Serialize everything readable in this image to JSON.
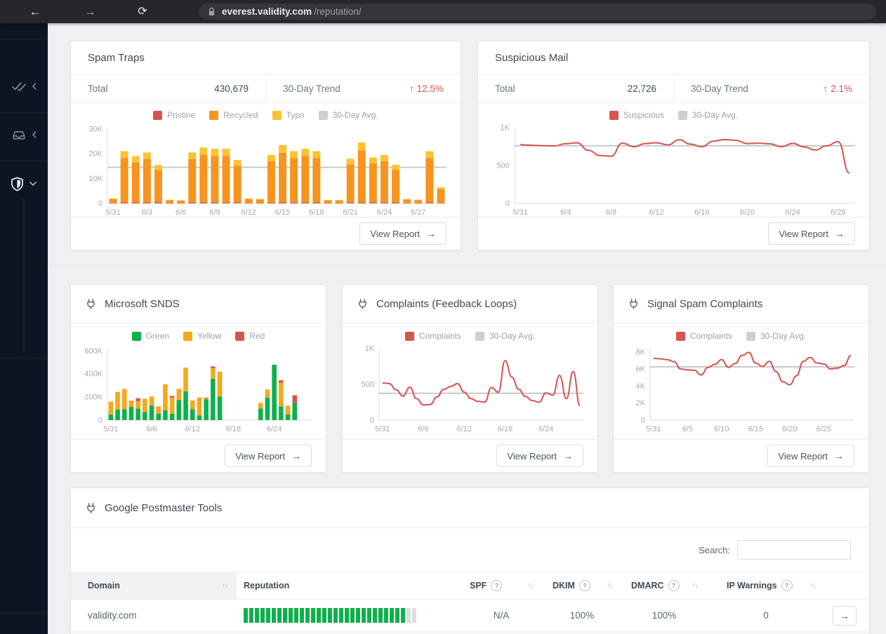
{
  "browser": {
    "url_host": "everest.validity.com",
    "url_path": "/reputation/"
  },
  "icons": {
    "back": "←",
    "forward": "→",
    "reload": "⟳",
    "trend_up": "↑",
    "arrow_right": "→",
    "sort": "↑↓",
    "help": "?"
  },
  "sidebar": {
    "items": [
      {
        "icon": "double-check-icon",
        "state": "collapsed"
      },
      {
        "icon": "inbox-tray-icon",
        "state": "collapsed"
      },
      {
        "icon": "shield-icon",
        "state": "expanded",
        "active": true
      }
    ]
  },
  "cards": {
    "spam_traps": {
      "title": "Spam Traps",
      "total_label": "Total",
      "total_value": "430,679",
      "trend_label": "30-Day Trend",
      "trend_value": "12.5%",
      "view_report_label": "View Report",
      "chart": {
        "type": "stacked_bar",
        "ymax": 30.5,
        "yticks": [
          [
            0,
            "0"
          ],
          [
            10,
            "10K"
          ],
          [
            20,
            "20K"
          ],
          [
            30,
            "30K"
          ]
        ],
        "avg": 14.5,
        "avg_label": "30-Day Avg.",
        "avg_color": "#c6c9cc",
        "unit": "K",
        "xlabels": [
          "5/31",
          "",
          "",
          "6/3",
          "",
          "",
          "6/6",
          "",
          "",
          "6/9",
          "",
          "",
          "6/12",
          "",
          "",
          "6/15",
          "",
          "",
          "6/18",
          "",
          "",
          "6/21",
          "",
          "",
          "6/24",
          "",
          "",
          "6/27",
          "",
          ""
        ],
        "series": [
          {
            "name": "Pristine",
            "color": "#d9534f",
            "values": [
              0.1,
              0.4,
              0.4,
              0.4,
              0.4,
              0.1,
              0.1,
              0.4,
              0.4,
              0.4,
              0.4,
              0.4,
              0.1,
              0.1,
              0.4,
              0.4,
              0.4,
              0.4,
              0.4,
              0.1,
              0.1,
              0.4,
              0.4,
              0.4,
              0.4,
              0.4,
              0.1,
              0.1,
              0.4,
              0.2
            ]
          },
          {
            "name": "Recycled",
            "color": "#f7941e",
            "values": [
              1.6,
              17.9,
              16.1,
              17.4,
              13.1,
              1.2,
              1.0,
              17.4,
              19.2,
              18.7,
              18.7,
              14.8,
              1.6,
              1.5,
              16.6,
              20.0,
              17.9,
              18.7,
              17.9,
              1.1,
              1.1,
              15.3,
              20.9,
              15.7,
              16.6,
              13.1,
              1.5,
              1.2,
              17.9,
              5.5
            ]
          },
          {
            "name": "Typo",
            "color": "#fdc330",
            "values": [
              0.3,
              2.7,
              2.5,
              2.7,
              2.0,
              0.2,
              0.2,
              2.7,
              2.9,
              2.9,
              2.9,
              2.3,
              0.3,
              0.2,
              2.5,
              3.1,
              2.7,
              2.9,
              2.7,
              0.2,
              0.2,
              2.3,
              3.2,
              2.4,
              2.5,
              2.0,
              0.2,
              0.2,
              2.7,
              0.8
            ]
          }
        ]
      }
    },
    "suspicious_mail": {
      "title": "Suspicious Mail",
      "total_label": "Total",
      "total_value": "22,726",
      "trend_label": "30-Day Trend",
      "trend_value": "2.1%",
      "view_report_label": "View Report",
      "chart": {
        "type": "line",
        "ymax": 1000,
        "yticks": [
          [
            0,
            "0"
          ],
          [
            500,
            "500"
          ],
          [
            1000,
            "1K"
          ]
        ],
        "avg": 760,
        "avg_label": "30-Day Avg.",
        "avg_color": "#c6c9cc",
        "xlabels": [
          "5/31",
          "",
          "",
          "",
          "6/4",
          "",
          "",
          "",
          "6/8",
          "",
          "",
          "",
          "6/12",
          "",
          "",
          "",
          "6/16",
          "",
          "",
          "",
          "6/20",
          "",
          "",
          "",
          "6/24",
          "",
          "",
          "",
          "6/28",
          ""
        ],
        "series": [
          {
            "name": "Suspicious",
            "color": "#d9534f",
            "values": [
              775,
              768,
              762,
              758,
              788,
              800,
              700,
              632,
              622,
              795,
              748,
              790,
              800,
              772,
              840,
              782,
              748,
              822,
              843,
              832,
              790,
              795,
              786,
              748,
              792,
              745,
              705,
              760,
              815,
              400
            ]
          }
        ]
      }
    },
    "microsoft_snds": {
      "title": "Microsoft SNDS",
      "view_report_label": "View Report",
      "chart": {
        "type": "stacked_bar",
        "ymax": 620,
        "yticks": [
          [
            0,
            "0"
          ],
          [
            200,
            "200K"
          ],
          [
            400,
            "400K"
          ],
          [
            600,
            "600K"
          ]
        ],
        "avg": null,
        "avg_label": null,
        "avg_color": "#c6c9cc",
        "unit": "K",
        "xlabels": [
          "5/31",
          "",
          "",
          "",
          "",
          "",
          "6/6",
          "",
          "",
          "",
          "",
          "",
          "6/12",
          "",
          "",
          "",
          "",
          "",
          "6/18",
          "",
          "",
          "",
          "",
          "",
          "6/24",
          "",
          "",
          "",
          "",
          ""
        ],
        "series": [
          {
            "name": "Green",
            "color": "#0db14b",
            "values": [
              50,
              90,
              95,
              115,
              100,
              70,
              125,
              55,
              85,
              55,
              175,
              250,
              95,
              40,
              180,
              360,
              205,
              0,
              0,
              0,
              0,
              0,
              100,
              195,
              480,
              120,
              50,
              150,
              0,
              0
            ]
          },
          {
            "name": "Yellow",
            "color": "#f7a81b",
            "values": [
              110,
              155,
              175,
              55,
              65,
              115,
              80,
              65,
              225,
              140,
              95,
              205,
              75,
              155,
              10,
              90,
              215,
              0,
              0,
              0,
              0,
              0,
              50,
              70,
              0,
              205,
              75,
              0,
              0,
              0
            ]
          },
          {
            "name": "Red",
            "color": "#d9534f",
            "values": [
              0,
              0,
              0,
              0,
              25,
              0,
              0,
              0,
              0,
              15,
              0,
              0,
              0,
              0,
              5,
              15,
              0,
              0,
              0,
              0,
              0,
              0,
              0,
              0,
              0,
              20,
              0,
              65,
              0,
              0
            ]
          }
        ]
      }
    },
    "complaints_fbl": {
      "title": "Complaints (Feedback Loops)",
      "view_report_label": "View Report",
      "chart": {
        "type": "line",
        "ymax": 1000,
        "yticks": [
          [
            0,
            "0"
          ],
          [
            500,
            "500"
          ],
          [
            1000,
            "1K"
          ]
        ],
        "avg": 375,
        "avg_label": "30-Day Avg.",
        "avg_color": "#c6c9cc",
        "xlabels": [
          "5/31",
          "",
          "",
          "",
          "",
          "",
          "6/6",
          "",
          "",
          "",
          "",
          "",
          "6/12",
          "",
          "",
          "",
          "",
          "",
          "6/18",
          "",
          "",
          "",
          "",
          "",
          "6/24",
          "",
          "",
          "",
          "",
          ""
        ],
        "series": [
          {
            "name": "Complaints",
            "color": "#d9534f",
            "values": [
              520,
              510,
              425,
              335,
              460,
              300,
              212,
              218,
              325,
              430,
              470,
              510,
              390,
              300,
              262,
              250,
              455,
              390,
              830,
              600,
              430,
              330,
              272,
              250,
              380,
              348,
              625,
              300,
              680,
              200
            ]
          }
        ]
      }
    },
    "signal_spam": {
      "title": "Signal Spam Complaints",
      "view_report_label": "View Report",
      "chart": {
        "type": "line",
        "ymax": 8.4,
        "yticks": [
          [
            0,
            "0"
          ],
          [
            2,
            "2K"
          ],
          [
            4,
            "4K"
          ],
          [
            6,
            "6K"
          ],
          [
            8,
            "8K"
          ]
        ],
        "avg": 6.25,
        "avg_label": "30-Day Avg.",
        "avg_color": "#c6c9cc",
        "unit": "K",
        "xlabels": [
          "5/31",
          "",
          "",
          "",
          "",
          "6/5",
          "",
          "",
          "",
          "",
          "6/10",
          "",
          "",
          "",
          "",
          "6/15",
          "",
          "",
          "",
          "",
          "6/20",
          "",
          "",
          "",
          "",
          "6/25",
          "",
          "",
          "",
          ""
        ],
        "series": [
          {
            "name": "Complaints",
            "color": "#d9534f",
            "values": [
              7.25,
              7.2,
              7.1,
              6.85,
              6.0,
              5.9,
              5.85,
              5.3,
              6.2,
              6.55,
              7.1,
              6.2,
              6.65,
              7.6,
              7.95,
              6.7,
              6.3,
              6.9,
              5.7,
              4.5,
              4.15,
              5.2,
              6.9,
              7.35,
              6.7,
              6.6,
              6.0,
              6.1,
              6.4,
              7.6
            ]
          }
        ]
      }
    },
    "google_postmaster": {
      "title": "Google Postmaster Tools",
      "search_label": "Search:",
      "table": {
        "headers": {
          "domain": "Domain",
          "reputation": "Reputation",
          "spf": "SPF",
          "dkim": "DKIM",
          "dmarc": "DMARC",
          "ip_warnings": "IP Warnings"
        },
        "rows": [
          {
            "domain": "validity.com",
            "reputation_segments": 31,
            "reputation_filled": 29,
            "reputation_color": "#0db14b",
            "spf": "N/A",
            "dkim": "100%",
            "dmarc": "100%",
            "ip_warnings": "0"
          }
        ]
      }
    }
  }
}
